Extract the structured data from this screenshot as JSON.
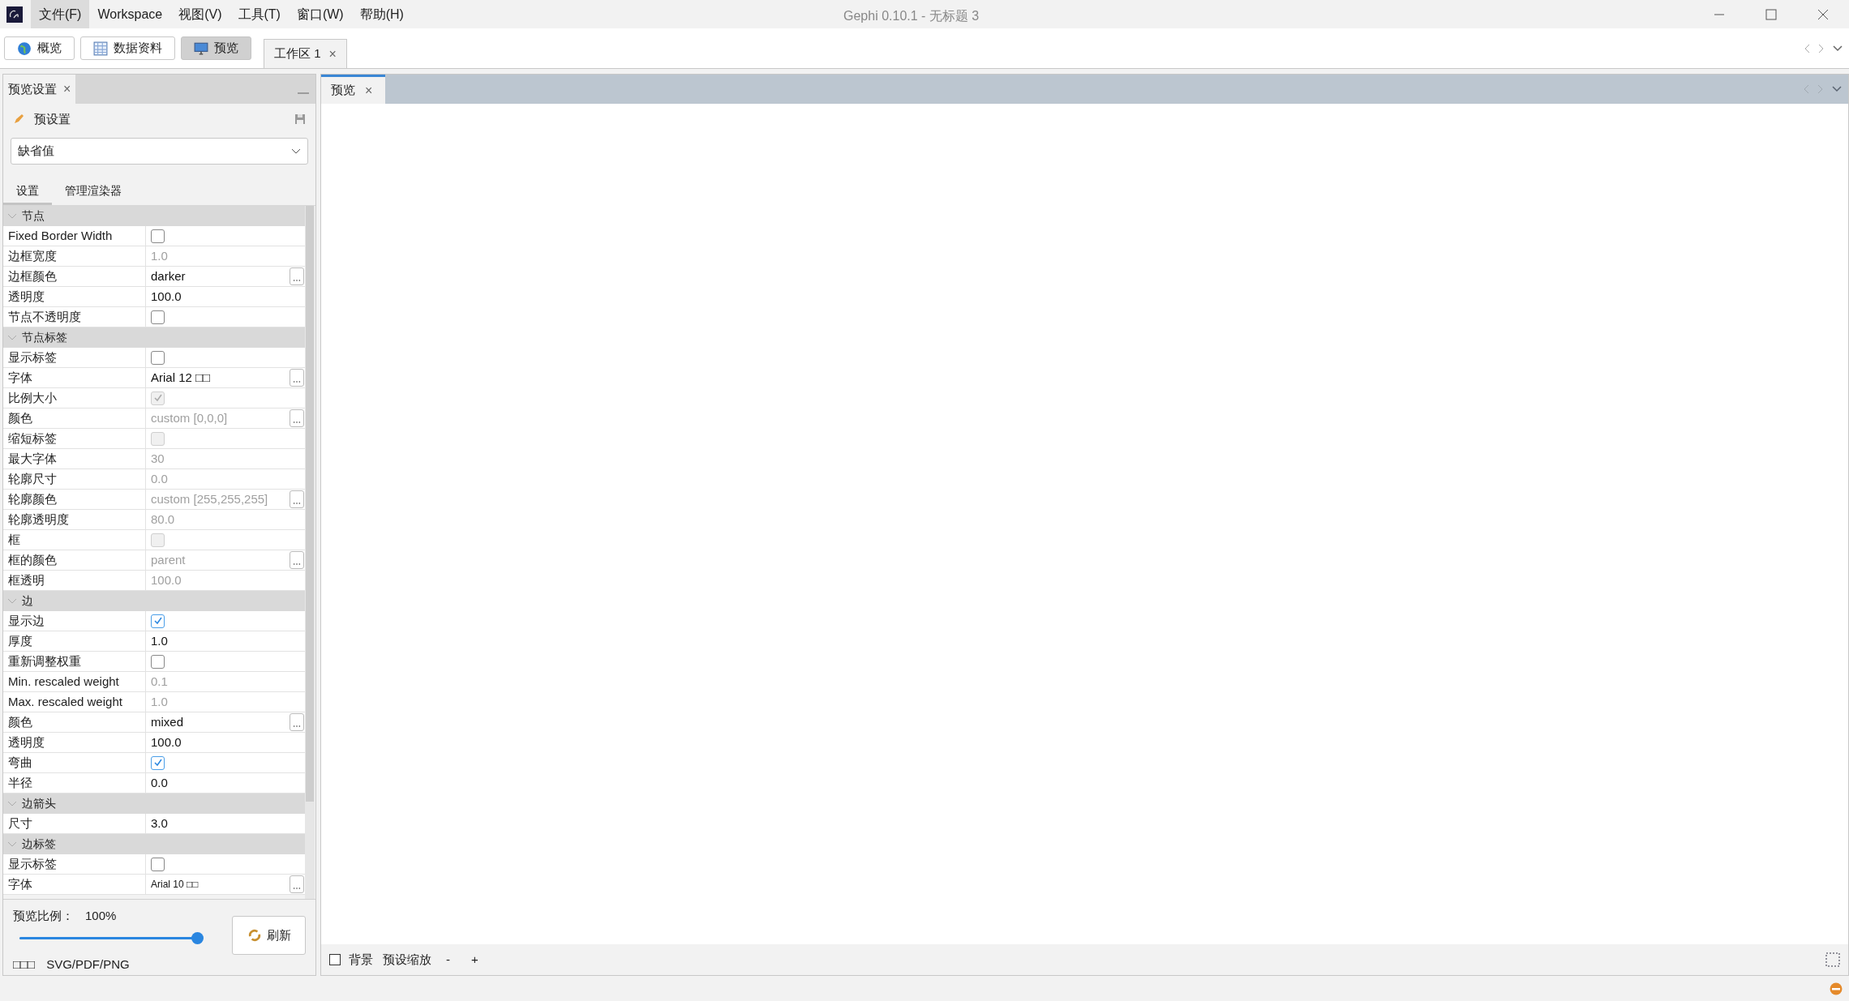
{
  "window": {
    "title": "Gephi 0.10.1 - 无标题 3"
  },
  "menu": [
    {
      "label": "文件(F)",
      "highlighted": true
    },
    {
      "label": "Workspace",
      "highlighted": false
    },
    {
      "label": "视图(V)",
      "highlighted": false
    },
    {
      "label": "工具(T)",
      "highlighted": false
    },
    {
      "label": "窗口(W)",
      "highlighted": false
    },
    {
      "label": "帮助(H)",
      "highlighted": false
    }
  ],
  "toolbar": [
    {
      "label": "概览",
      "kind": "globe",
      "selected": false
    },
    {
      "label": "数据资料",
      "kind": "table",
      "selected": false
    },
    {
      "label": "预览",
      "kind": "monitor",
      "selected": true
    }
  ],
  "workspace_tab": {
    "label": "工作区 1",
    "close": "×"
  },
  "settings_panel": {
    "tab": "预览设置",
    "close": "×",
    "preset_label": "预设置",
    "preset_value": "缺省值",
    "tabs": [
      {
        "label": "设置",
        "selected": true
      },
      {
        "label": "管理渲染器",
        "selected": false
      }
    ],
    "sections": [
      {
        "title": "节点",
        "expanded": true,
        "rows": [
          {
            "label": "Fixed Border Width",
            "kind": "check",
            "checked": false,
            "disabled": false
          },
          {
            "label": "边框宽度",
            "kind": "text",
            "value": "1.0",
            "disabled": true,
            "button": false
          },
          {
            "label": "边框颜色",
            "kind": "text",
            "value": "darker",
            "disabled": false,
            "button": true
          },
          {
            "label": "透明度",
            "kind": "text",
            "value": "100.0",
            "disabled": false,
            "button": false
          },
          {
            "label": "节点不透明度",
            "kind": "check",
            "checked": false,
            "disabled": false
          }
        ]
      },
      {
        "title": "节点标签",
        "expanded": true,
        "rows": [
          {
            "label": "显示标签",
            "kind": "check",
            "checked": false,
            "disabled": false
          },
          {
            "label": "字体",
            "kind": "text",
            "value": "Arial 12 □□",
            "disabled": false,
            "button": true
          },
          {
            "label": "比例大小",
            "kind": "check",
            "checked": true,
            "disabled": true
          },
          {
            "label": "颜色",
            "kind": "text",
            "value": "custom [0,0,0]",
            "disabled": true,
            "button": true
          },
          {
            "label": "缩短标签",
            "kind": "check",
            "checked": false,
            "disabled": true
          },
          {
            "label": "最大字体",
            "kind": "text",
            "value": "30",
            "disabled": true,
            "button": false
          },
          {
            "label": "轮廓尺寸",
            "kind": "text",
            "value": "0.0",
            "disabled": true,
            "button": false
          },
          {
            "label": "轮廓颜色",
            "kind": "text",
            "value": "custom [255,255,255]",
            "disabled": true,
            "button": true
          },
          {
            "label": "轮廓透明度",
            "kind": "text",
            "value": "80.0",
            "disabled": true,
            "button": false
          },
          {
            "label": "框",
            "kind": "check",
            "checked": false,
            "disabled": true
          },
          {
            "label": "框的颜色",
            "kind": "text",
            "value": "parent",
            "disabled": true,
            "button": true
          },
          {
            "label": "框透明",
            "kind": "text",
            "value": "100.0",
            "disabled": true,
            "button": false
          }
        ]
      },
      {
        "title": "边",
        "expanded": true,
        "rows": [
          {
            "label": "显示边",
            "kind": "check",
            "checked": true,
            "disabled": false
          },
          {
            "label": "厚度",
            "kind": "text",
            "value": "1.0",
            "disabled": false,
            "button": false
          },
          {
            "label": "重新调整权重",
            "kind": "check",
            "checked": false,
            "disabled": false
          },
          {
            "label": "Min. rescaled weight",
            "kind": "text",
            "value": "0.1",
            "disabled": true,
            "button": false
          },
          {
            "label": "Max. rescaled weight",
            "kind": "text",
            "value": "1.0",
            "disabled": true,
            "button": false
          },
          {
            "label": "颜色",
            "kind": "text",
            "value": "mixed",
            "disabled": false,
            "button": true
          },
          {
            "label": "透明度",
            "kind": "text",
            "value": "100.0",
            "disabled": false,
            "button": false
          },
          {
            "label": "弯曲",
            "kind": "check",
            "checked": true,
            "disabled": false
          },
          {
            "label": "半径",
            "kind": "text",
            "value": "0.0",
            "disabled": false,
            "button": false
          }
        ]
      },
      {
        "title": "边箭头",
        "expanded": true,
        "rows": [
          {
            "label": "尺寸",
            "kind": "text",
            "value": "3.0",
            "disabled": false,
            "button": false
          }
        ]
      },
      {
        "title": "边标签",
        "expanded": true,
        "rows": [
          {
            "label": "显示标签",
            "kind": "check",
            "checked": false,
            "disabled": false
          },
          {
            "label": "字体",
            "kind": "text",
            "value": "Arial 10 □□",
            "disabled": false,
            "button": true,
            "small": true
          }
        ]
      }
    ],
    "ratio_label": "预览比例：",
    "ratio_value": "100%",
    "slider": {
      "level": 1.0
    },
    "refresh": "刷新",
    "export_label": "□□□",
    "export_formats": "SVG/PDF/PNG"
  },
  "preview_panel": {
    "tab": "预览",
    "close": "×",
    "background": {
      "label": "背景",
      "checked": false
    },
    "zoom_label": "预设缩放",
    "zoom_out": "-",
    "zoom_in": "+"
  }
}
